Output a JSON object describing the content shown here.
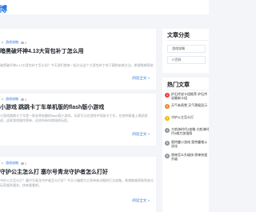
{
  "header": {
    "brand": "博"
  },
  "articles": [
    {
      "category": "游戏攻略",
      "views": "2",
      "title": "暗黑破坏神4.13大背包补丁怎么用",
      "excerpt": "暗黑破坏神4.13大背包补丁怎么用？今天我们就来一起讨论这个大背包补丁的下载和安装方法，希望能够帮助到大家，一起来看看吧。",
      "read_more": "阅读全文 »"
    },
    {
      "category": "游戏攻略",
      "views": "3",
      "title": "小游戏 跳跳卡丁车单机版的flash版小游戏",
      "excerpt": "小游戏跳跳卡丁车是一款非常有趣的flash版小游戏，玩家可以在游戏中驾驶卡丁车，在各种赛道上跳跃前进，这款游戏操作简单，适合所有年龄段的玩家。",
      "read_more": "阅读全文 »"
    },
    {
      "category": "游戏攻略",
      "views": "2",
      "title": "守护公主怎么打 塞尔号青龙守护者怎么打好",
      "excerpt": "守护公主怎么打？塞尔号青龙守护者怎么打好？今天小编就为大家带来详细的打法攻略，希望能够帮助到各位玩家顺利通关，快来看看吧。",
      "read_more": "阅读全文 »"
    }
  ],
  "sidebar": {
    "category_title": "文章分类",
    "categories": [
      "游戏攻略",
      "IT百科"
    ],
    "hot_title": "热门文章",
    "hot_articles": [
      {
        "num": "1",
        "text": "炉石传说卡组推荐 炉石传说最新卡组",
        "color": "#e8403f"
      },
      {
        "num": "2",
        "text": "天气有雨雪 天气预报显示",
        "color": "#f08a24"
      },
      {
        "num": "3",
        "text": "守护公主怎么打",
        "color": "#f5b800"
      },
      {
        "num": "4",
        "text": "大航海时代4攻略 大航海时代4威力加强版",
        "color": "#8d949e"
      },
      {
        "num": "5",
        "text": "奥特曼小游戏 奥特曼格斗进化",
        "color": "#8d949e"
      },
      {
        "num": "6",
        "text": "原神怎么升级快 原神快速升级",
        "color": "#8d949e"
      }
    ]
  }
}
